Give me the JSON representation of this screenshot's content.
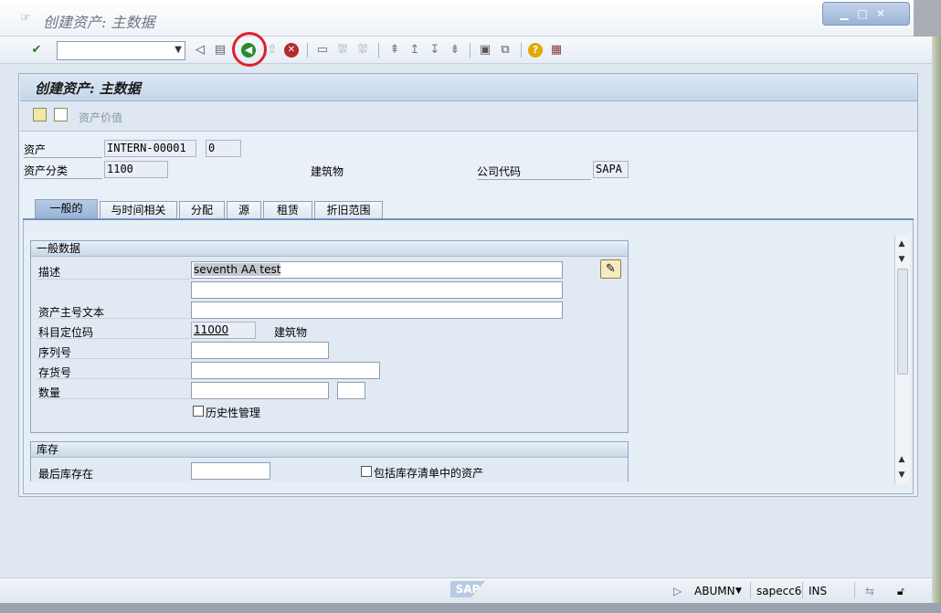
{
  "window": {
    "title": "创建资产: 主数据",
    "controls": [
      "minimize",
      "maximize",
      "close"
    ]
  },
  "toolbar": {
    "command_value": "",
    "icons": [
      "enter-icon",
      "back-triangle-icon",
      "save-icon",
      "back-icon",
      "exit-icon",
      "cancel-icon",
      "print-icon",
      "find-icon",
      "find-next-icon",
      "first-page-icon",
      "prev-page-icon",
      "next-page-icon",
      "last-page-icon",
      "create-session-icon",
      "shortcut-icon",
      "help-icon",
      "layout-icon"
    ]
  },
  "screen": {
    "heading": "创建资产: 主数据",
    "appbar_label": "资产价值"
  },
  "header_fields": {
    "asset_label": "资产",
    "asset_value": "INTERN-00001",
    "subnumber_value": "0",
    "class_label": "资产分类",
    "class_value": "1100",
    "class_text": "建筑物",
    "company_label": "公司代码",
    "company_value": "SAPA"
  },
  "tabs": [
    "一般的",
    "与时间相关",
    "分配",
    "源",
    "租赁",
    "折旧范围"
  ],
  "general_group": {
    "title": "一般数据",
    "description_label": "描述",
    "description_value": "seventh AA test",
    "description2_value": "",
    "main_text_label": "资产主号文本",
    "main_text_value": "",
    "account_label": "科目定位码",
    "account_value": "11000",
    "account_text": "建筑物",
    "serial_label": "序列号",
    "serial_value": "",
    "inventory_label": "存货号",
    "inventory_value": "",
    "quantity_label": "数量",
    "quantity_value": "",
    "unit_value": "",
    "history_label": "历史性管理",
    "history_checked": false
  },
  "inventory_group": {
    "title": "库存",
    "last_inventory_label": "最后库存在",
    "last_inventory_value": "",
    "include_list_label": "包括库存清单中的资产",
    "include_list_checked": false
  },
  "statusbar": {
    "logo": "SAP",
    "transaction": "ABUMN",
    "server": "sapecc6",
    "mode": "INS"
  },
  "colors": {
    "highlight_circle": "#e0202a",
    "tab_active": "#a7bfdd"
  }
}
